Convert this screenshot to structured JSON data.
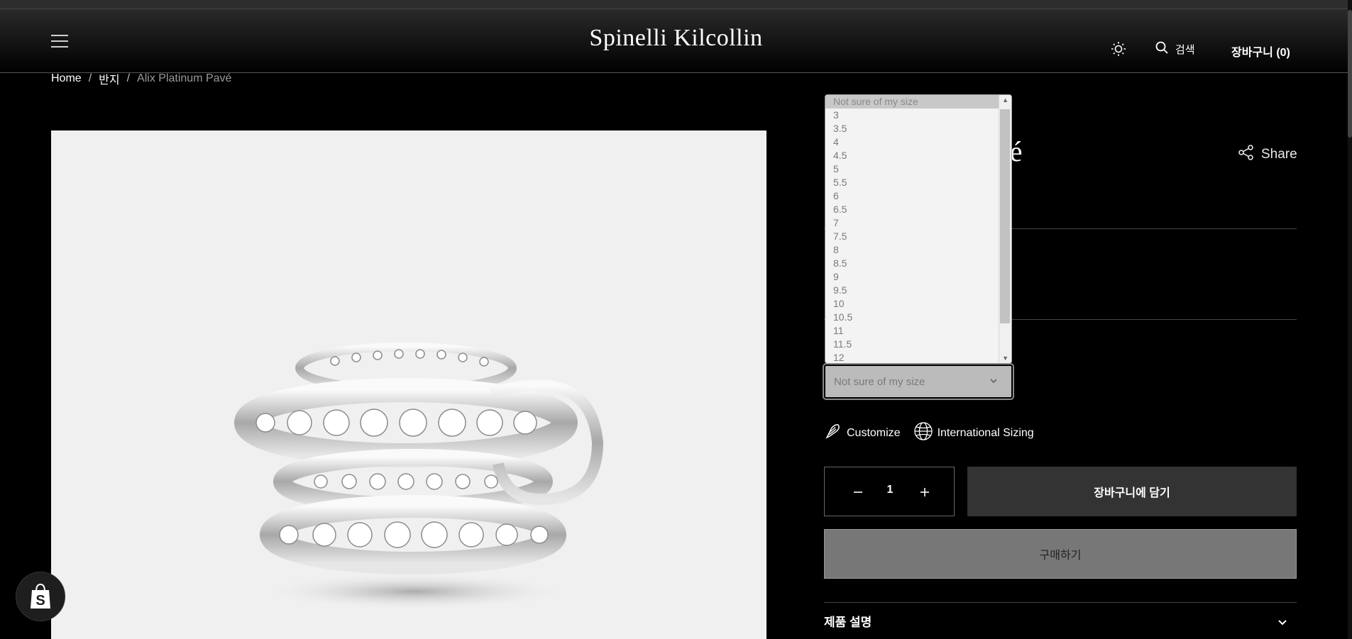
{
  "header": {
    "logo": "Spinelli Kilcollin",
    "search_label": "검색",
    "cart_label": "장바구니 (0)"
  },
  "breadcrumb": {
    "home": "Home",
    "category": "반지",
    "current": "Alix Platinum Pavé"
  },
  "product": {
    "title_visible_fragment": "avé",
    "share_label": "Share"
  },
  "size_dropdown": {
    "selected": "Not sure of my size",
    "options": [
      "Not sure of my size",
      "3",
      "3.5",
      "4",
      "4.5",
      "5",
      "5.5",
      "6",
      "6.5",
      "7",
      "7.5",
      "8",
      "8.5",
      "9",
      "9.5",
      "10",
      "10.5",
      "11",
      "11.5",
      "12"
    ]
  },
  "options": {
    "customize": "Customize",
    "international_sizing": "International Sizing"
  },
  "quantity": {
    "value": "1"
  },
  "actions": {
    "add_to_cart": "장바구니에 담기",
    "buy_now": "구매하기"
  },
  "accordion": {
    "description_label": "제품 설명"
  },
  "colors": {
    "background": "#000000",
    "add_to_cart_bg": "#333333",
    "buy_now_bg": "#777777",
    "image_bg": "#f1f0f0"
  }
}
